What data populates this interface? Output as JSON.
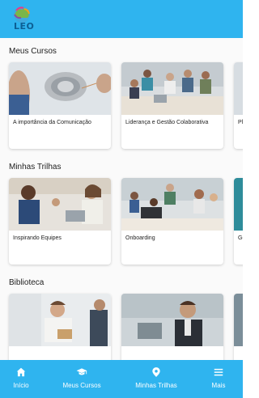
{
  "header": {
    "logo_text": "LEO"
  },
  "sections": [
    {
      "title": "Meus Cursos",
      "cards": [
        {
          "label": "A importância da Comunicação"
        },
        {
          "label": "Liderança e Gestão Colaborativa"
        },
        {
          "label": "Pl"
        }
      ]
    },
    {
      "title": "Minhas Trilhas",
      "cards": [
        {
          "label": "Inspirando Equipes"
        },
        {
          "label": "Onboarding"
        },
        {
          "label": "Ge"
        }
      ]
    },
    {
      "title": "Biblioteca",
      "cards": [
        {
          "label": ""
        },
        {
          "label": ""
        },
        {
          "label": ""
        }
      ]
    }
  ],
  "bottom_nav": [
    {
      "label": "Início",
      "icon": "home-icon"
    },
    {
      "label": "Meus Cursos",
      "icon": "graduation-cap-icon"
    },
    {
      "label": "Minhas Trilhas",
      "icon": "map-pin-icon"
    },
    {
      "label": "Mais",
      "icon": "menu-icon"
    }
  ],
  "colors": {
    "brand": "#2fb4ef",
    "logo": "#0d5f94"
  }
}
